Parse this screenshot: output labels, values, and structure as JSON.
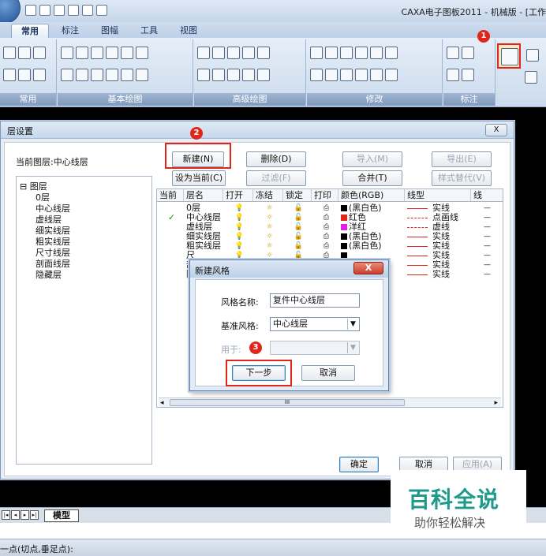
{
  "window": {
    "title": "CAXA电子图板2011 - 机械版 - [工作"
  },
  "tabs": [
    {
      "label": "常用",
      "active": true
    },
    {
      "label": "标注"
    },
    {
      "label": "图幅"
    },
    {
      "label": "工具"
    },
    {
      "label": "视图"
    }
  ],
  "ribbon": {
    "groups": [
      "常用",
      "基本绘图",
      "高级绘图",
      "修改",
      "标注"
    ]
  },
  "badges": {
    "one": "1",
    "two": "2",
    "three": "3"
  },
  "dialog": {
    "title": "层设置",
    "close_icon": "X",
    "current_layer": "当前图层:中心线层",
    "buttons": {
      "new": "新建(N)",
      "delete": "删除(D)",
      "import": "导入(M)",
      "export": "导出(E)",
      "set_current": "设为当前(C)",
      "filter": "过滤(F)",
      "merge": "合并(T)",
      "style_replace": "样式替代(V)",
      "ok": "确定",
      "cancel": "取消",
      "apply": "应用(A)"
    },
    "tree": {
      "root": "图层",
      "items": [
        "0层",
        "中心线层",
        "虚线层",
        "细实线层",
        "粗实线层",
        "尺寸线层",
        "剖面线层",
        "隐藏层"
      ]
    },
    "table": {
      "headers": [
        "当前",
        "层名",
        "打开",
        "冻结",
        "锁定",
        "打印",
        "颜色(RGB)",
        "线型",
        "线"
      ],
      "rows": [
        {
          "current": "",
          "name": "0层",
          "color_name": "(黑白色)",
          "color": "#000000",
          "linetype": "实线"
        },
        {
          "current": "✓",
          "name": "中心线层",
          "color_name": "红色",
          "color": "#e0261b",
          "linetype": "点画线"
        },
        {
          "current": "",
          "name": "虚线层",
          "color_name": "洋红",
          "color": "#e020e0",
          "linetype": "虚线"
        },
        {
          "current": "",
          "name": "细实线层",
          "color_name": "(黑白色)",
          "color": "#000000",
          "linetype": "实线"
        },
        {
          "current": "",
          "name": "粗实线层",
          "color_name": "(黑白色)",
          "color": "#000000",
          "linetype": "实线"
        },
        {
          "current": "",
          "name": "尺",
          "color_name": "",
          "color": "#000000",
          "linetype": "实线"
        },
        {
          "current": "",
          "name": "剖",
          "color_name": "",
          "color": "#000000",
          "linetype": "实线"
        },
        {
          "current": "",
          "name": "隐",
          "color_name": "",
          "color": "#000000",
          "linetype": "实线"
        }
      ],
      "scroll_thumb": "III"
    }
  },
  "new_style": {
    "title": "新建风格",
    "name_label": "风格名称:",
    "name_value": "复件中心线层",
    "base_label": "基准风格:",
    "base_value": "中心线层",
    "use_label": "用于:",
    "use_value": "",
    "next_button": "下一步",
    "cancel_button": "取消"
  },
  "model_tab": "模型",
  "status": {
    "prompt": "一点(切点,垂足点):"
  },
  "watermark": {
    "line1": "百科全说",
    "line2": "助你轻松解决"
  }
}
